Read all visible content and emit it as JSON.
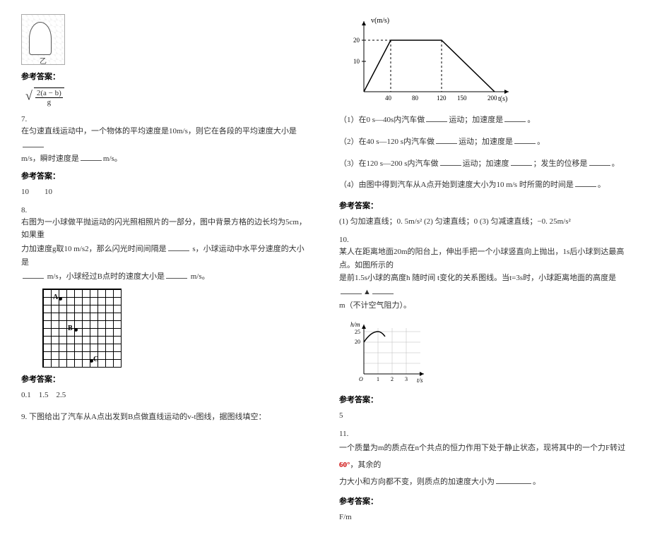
{
  "illus_label": "乙",
  "ans_label": "参考答案：",
  "q6_formula": {
    "num": "2(a − b)",
    "den": "g"
  },
  "q7": {
    "num": "7.",
    "text_a": "在匀速直线运动中，一个物体的平均速度是10m/s，则它在各段的平均速度大小是",
    "text_b": "m/s，瞬时速度是",
    "text_c": "m/s。",
    "ans": "10　　10"
  },
  "q8": {
    "num": "8.",
    "line1": "右图为一小球做平抛运动的闪光照相照片的一部分，图中背景方格的边长均为5cm，如果重",
    "line2_a": "力加速度g取10 m/s2，那么闪光时间间隔是",
    "line2_b": " s，小球运动中水平分速度的大小是",
    "line3_a": " m/s，小球经过B点时的速度大小是",
    "line3_b": " m/s。",
    "ans": "0.1　1.5　2.5",
    "points": {
      "A": "A",
      "B": "B",
      "C": "C"
    }
  },
  "q9": {
    "num": "9.",
    "text": "下图给出了汽车从A点出发到B点做直线运动的v-t图线，据图线填空：",
    "chart_data": {
      "type": "line",
      "ylabel": "v(m/s)",
      "xlabel": "t(s)",
      "yticks": [
        10,
        20
      ],
      "xticks": [
        40,
        80,
        120,
        150,
        200
      ],
      "points": [
        [
          0,
          0
        ],
        [
          40,
          20
        ],
        [
          120,
          20
        ],
        [
          200,
          0
        ]
      ]
    },
    "sub1_a": "（1）在0 s—40s内汽车做",
    "sub1_b": "运动；加速度是",
    "sub1_c": "。",
    "sub2_a": "（2）在40 s—120 s内汽车做",
    "sub2_b": "运动；加速度是",
    "sub2_c": "。",
    "sub3_a": "（3）在120 s—200 s内汽车做",
    "sub3_b": "运动；加速度",
    "sub3_c": "；发生的位移是",
    "sub3_d": "。",
    "sub4_a": "（4）由图中得到汽车从A点开始到速度大小为10 m/s 时所需的时间是",
    "sub4_b": "。",
    "ans": "(1) 匀加速直线；0. 5m/s² (2) 匀速直线；0 (3) 匀减速直线；−0. 25m/s²"
  },
  "q10": {
    "num": "10.",
    "line1": "某人在距离地面20m的阳台上，伸出手把一个小球竖直向上抛出，1s后小球到达最高点。如图所示的",
    "line2_a": "是前1.5s小球的高度h 随时间 t变化的关系图线。当t=3s时，小球距离地面的高度是",
    "line2_b": "▲",
    "line3": "m（不计空气阻力）。",
    "chart_data": {
      "type": "line",
      "ylabel": "h/m",
      "xlabel": "t/s",
      "yticks": [
        20,
        25
      ],
      "xticks": [
        1,
        2,
        3
      ],
      "xlim": [
        0,
        3.5
      ],
      "ylim": [
        0,
        28
      ]
    },
    "ans": "5"
  },
  "q11": {
    "num": "11.",
    "text_a": "一个质量为m的质点在n个共点的恒力作用下处于静止状态，现将其中的一个力F转过",
    "angle": "60°",
    "text_b": "，其余的",
    "text_c": "力大小和方向都不变，则质点的加速度大小为",
    "text_d": "。",
    "ans": "F/m"
  }
}
